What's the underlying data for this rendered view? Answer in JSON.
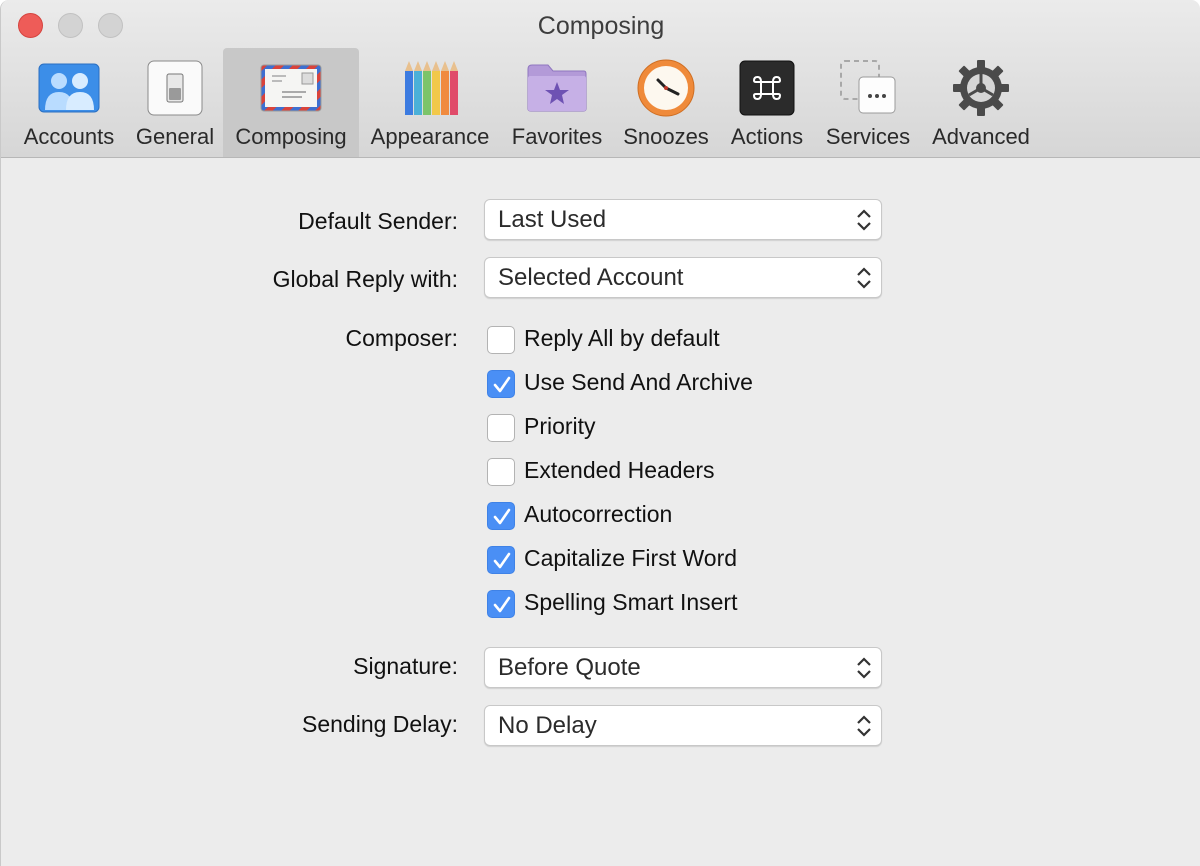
{
  "window": {
    "title": "Composing",
    "traffic_lights": {
      "close_color": "#ee5c58",
      "inactive_color": "#d3d3d3"
    }
  },
  "toolbar": {
    "items": [
      {
        "label": "Accounts",
        "icon": "accounts-icon",
        "selected": false
      },
      {
        "label": "General",
        "icon": "general-switch-icon",
        "selected": false
      },
      {
        "label": "Composing",
        "icon": "envelope-icon",
        "selected": true
      },
      {
        "label": "Appearance",
        "icon": "pencils-icon",
        "selected": false
      },
      {
        "label": "Favorites",
        "icon": "star-folder-icon",
        "selected": false
      },
      {
        "label": "Snoozes",
        "icon": "clock-icon",
        "selected": false
      },
      {
        "label": "Actions",
        "icon": "command-icon",
        "selected": false
      },
      {
        "label": "Services",
        "icon": "services-icon",
        "selected": false
      },
      {
        "label": "Advanced",
        "icon": "gear-icon",
        "selected": false
      }
    ]
  },
  "form": {
    "default_sender": {
      "label": "Default Sender:",
      "value": "Last Used"
    },
    "global_reply": {
      "label": "Global Reply with:",
      "value": "Selected Account"
    },
    "composer": {
      "label": "Composer:",
      "options": [
        {
          "label": "Reply All by default",
          "checked": false
        },
        {
          "label": "Use Send And Archive",
          "checked": true
        },
        {
          "label": "Priority",
          "checked": false
        },
        {
          "label": "Extended Headers",
          "checked": false
        },
        {
          "label": "Autocorrection",
          "checked": true
        },
        {
          "label": "Capitalize First Word",
          "checked": true
        },
        {
          "label": "Spelling Smart Insert",
          "checked": true
        }
      ]
    },
    "signature": {
      "label": "Signature:",
      "value": "Before Quote"
    },
    "sending_delay": {
      "label": "Sending Delay:",
      "value": "No Delay"
    }
  },
  "colors": {
    "accent": "#4a8ff5",
    "selected_tab": "#c8c8c8"
  }
}
